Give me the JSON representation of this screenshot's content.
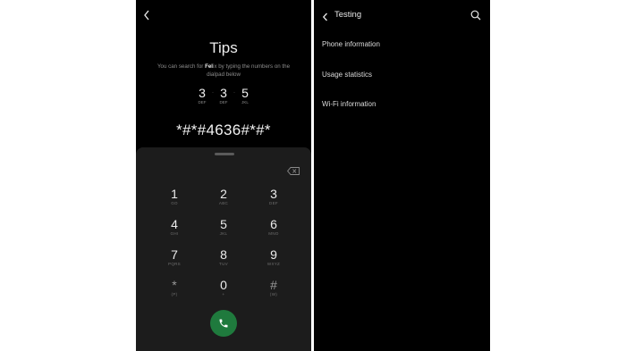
{
  "left_screen": {
    "back_icon": "chevron-left-icon",
    "tips_title": "Tips",
    "tips_pre": "You can search for",
    "tips_bold": "Fel",
    "tips_post": "ix by typing the numbers on the dialpad below",
    "code_hint": [
      {
        "number": "3",
        "letters": "DEF"
      },
      {
        "number": "3",
        "letters": "DEF"
      },
      {
        "number": "5",
        "letters": "JKL"
      }
    ],
    "code_separator": "·",
    "entered_code": "*#*#4636#*#*",
    "backspace_icon": "backspace-icon",
    "keys": [
      {
        "number": "1",
        "letters": "GO"
      },
      {
        "number": "2",
        "letters": "ABC"
      },
      {
        "number": "3",
        "letters": "DEF"
      },
      {
        "number": "4",
        "letters": "GHI"
      },
      {
        "number": "5",
        "letters": "JKL"
      },
      {
        "number": "6",
        "letters": "MNO"
      },
      {
        "number": "7",
        "letters": "PQRS"
      },
      {
        "number": "8",
        "letters": "TUV"
      },
      {
        "number": "9",
        "letters": "WXYZ"
      },
      {
        "number": "*",
        "letters": "(P)"
      },
      {
        "number": "0",
        "letters": "+"
      },
      {
        "number": "#",
        "letters": "(W)"
      }
    ],
    "call_icon": "phone-icon",
    "call_color": "#1f7a3d"
  },
  "right_screen": {
    "back_icon": "chevron-left-icon",
    "title": "Testing",
    "search_icon": "search-icon",
    "items": [
      "Phone information",
      "Usage statistics",
      "Wi-Fi information"
    ]
  }
}
